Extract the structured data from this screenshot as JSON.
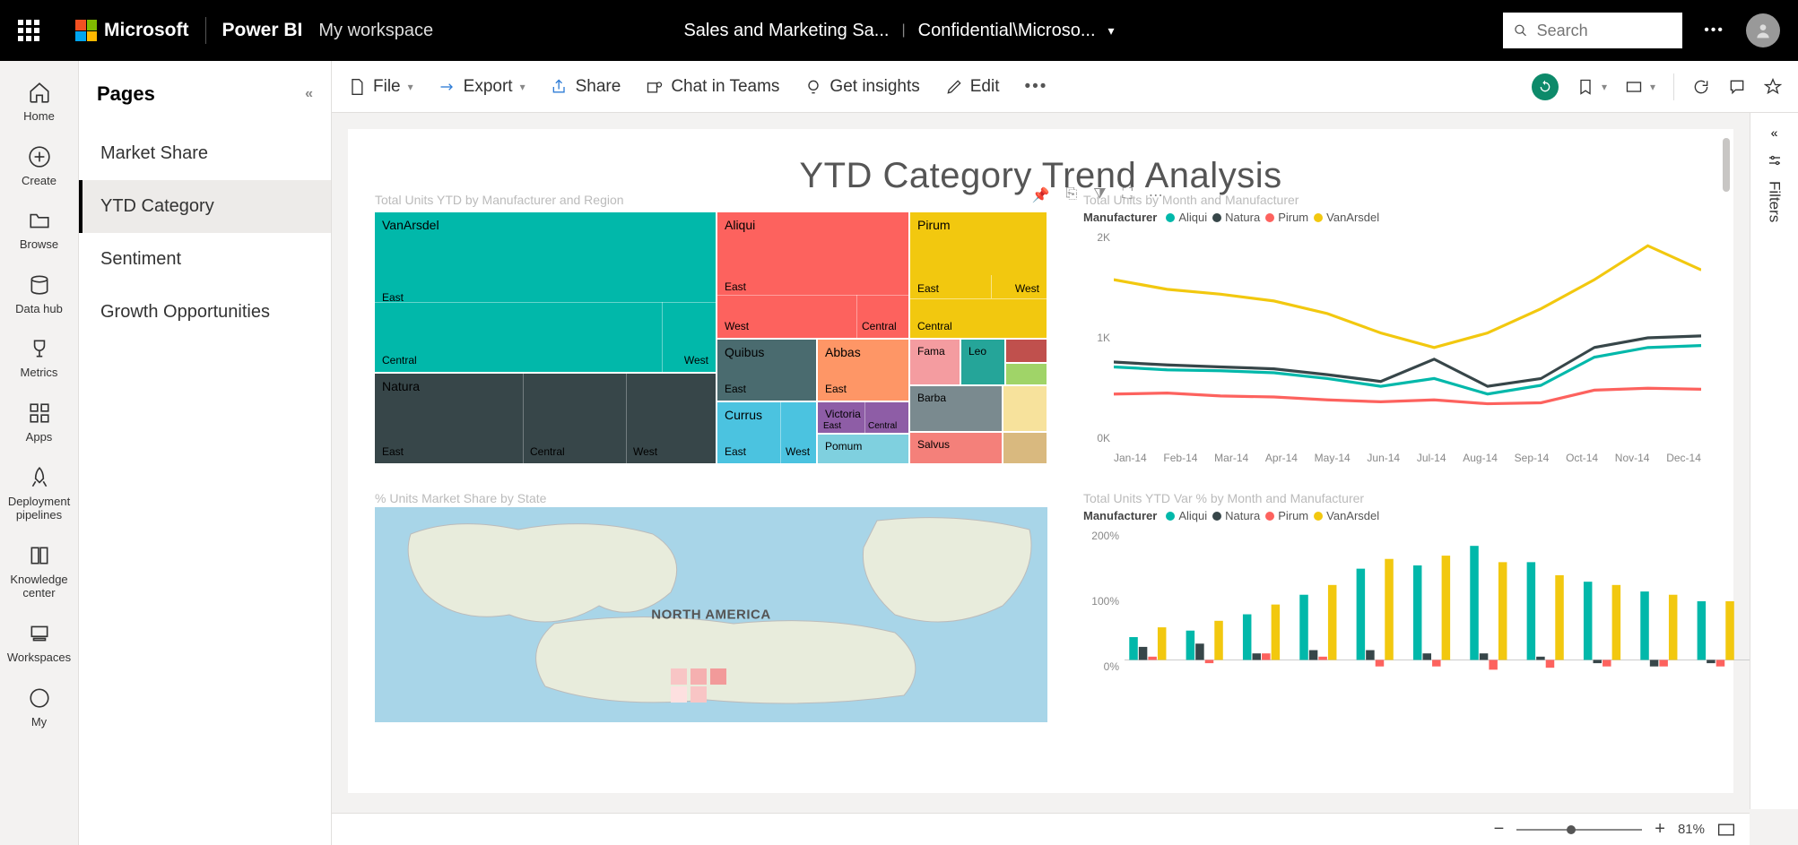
{
  "header": {
    "brand": "Microsoft",
    "product": "Power BI",
    "workspace": "My workspace",
    "report_title": "Sales and Marketing Sa...",
    "sensitivity": "Confidential\\Microso..."
  },
  "search": {
    "placeholder": "Search"
  },
  "rail": {
    "home": "Home",
    "create": "Create",
    "browse": "Browse",
    "datahub": "Data hub",
    "metrics": "Metrics",
    "apps": "Apps",
    "pipelines": "Deployment pipelines",
    "knowledge": "Knowledge center",
    "workspaces": "Workspaces",
    "my": "My"
  },
  "pages": {
    "header": "Pages",
    "items": [
      "Market Share",
      "YTD Category",
      "Sentiment",
      "Growth Opportunities"
    ],
    "active_index": 1
  },
  "commands": {
    "file": "File",
    "export": "Export",
    "share": "Share",
    "chat": "Chat in Teams",
    "insights": "Get insights",
    "edit": "Edit"
  },
  "zoom": {
    "percent": "81%"
  },
  "filters": {
    "label": "Filters"
  },
  "report": {
    "title": "YTD Category Trend Analysis",
    "treemap": {
      "title": "Total Units YTD by Manufacturer and Region",
      "labels": {
        "vanarsdel": "VanArsdel",
        "natura": "Natura",
        "aliqui": "Aliqui",
        "quibus": "Quibus",
        "currus": "Currus",
        "pirum": "Pirum",
        "abbas": "Abbas",
        "victoria": "Victoria",
        "pomum": "Pomum",
        "fama": "Fama",
        "leo": "Leo",
        "barba": "Barba",
        "salvus": "Salvus",
        "east": "East",
        "west": "West",
        "central": "Central"
      }
    },
    "line": {
      "title": "Total Units by Month and Manufacturer",
      "legend_label": "Manufacturer",
      "y_ticks": [
        "2K",
        "1K",
        "0K"
      ],
      "x_ticks": [
        "Jan-14",
        "Feb-14",
        "Mar-14",
        "Apr-14",
        "May-14",
        "Jun-14",
        "Jul-14",
        "Aug-14",
        "Sep-14",
        "Oct-14",
        "Nov-14",
        "Dec-14"
      ]
    },
    "map": {
      "title": "% Units Market Share by State",
      "label": "NORTH AMERICA"
    },
    "bars": {
      "title": "Total Units YTD Var % by Month and Manufacturer",
      "legend_label": "Manufacturer",
      "y_ticks": [
        "200%",
        "100%",
        "0%"
      ]
    },
    "legend_series": {
      "aliqui": "Aliqui",
      "natura": "Natura",
      "pirum": "Pirum",
      "vanarsdel": "VanArsdel"
    }
  },
  "colors": {
    "aliqui": "#01b8aa",
    "natura": "#374649",
    "pirum": "#fd625e",
    "vanarsdel": "#f2c80f",
    "orange": "#fe9666",
    "purple": "#8e5da6",
    "sky": "#4bc3e0",
    "teal": "#25a599"
  },
  "chart_data": [
    {
      "type": "treemap",
      "title": "Total Units YTD by Manufacturer and Region",
      "hierarchy": [
        {
          "name": "VanArsdel",
          "children": [
            {
              "name": "East",
              "value": 180
            },
            {
              "name": "West",
              "value": 60
            }
          ]
        },
        {
          "name": "Natura",
          "children": [
            {
              "name": "East",
              "value": 70
            },
            {
              "name": "Central",
              "value": 50
            },
            {
              "name": "West",
              "value": 40
            }
          ]
        },
        {
          "name": "Aliqui",
          "children": [
            {
              "name": "East",
              "value": 70
            },
            {
              "name": "West",
              "value": 40
            },
            {
              "name": "Central",
              "value": 20
            }
          ]
        },
        {
          "name": "Quibus",
          "children": [
            {
              "name": "East",
              "value": 35
            }
          ]
        },
        {
          "name": "Currus",
          "children": [
            {
              "name": "East",
              "value": 25
            },
            {
              "name": "West",
              "value": 20
            }
          ]
        },
        {
          "name": "Pirum",
          "children": [
            {
              "name": "East",
              "value": 40
            },
            {
              "name": "West",
              "value": 20
            },
            {
              "name": "Central",
              "value": 20
            }
          ]
        },
        {
          "name": "Abbas",
          "children": [
            {
              "name": "East",
              "value": 20
            }
          ]
        },
        {
          "name": "Victoria",
          "children": [
            {
              "name": "East",
              "value": 12
            },
            {
              "name": "Central",
              "value": 10
            }
          ]
        },
        {
          "name": "Pomum",
          "children": [
            {
              "name": "East",
              "value": 18
            }
          ]
        },
        {
          "name": "Fama",
          "children": [
            {
              "name": "East",
              "value": 10
            }
          ]
        },
        {
          "name": "Leo",
          "children": [
            {
              "name": "East",
              "value": 8
            }
          ]
        },
        {
          "name": "Barba",
          "children": [
            {
              "name": "East",
              "value": 12
            }
          ]
        },
        {
          "name": "Salvus",
          "children": [
            {
              "name": "East",
              "value": 10
            }
          ]
        }
      ]
    },
    {
      "type": "line",
      "title": "Total Units by Month and Manufacturer",
      "xlabel": "",
      "ylabel": "",
      "ylim": [
        0,
        2200
      ],
      "categories": [
        "Jan-14",
        "Feb-14",
        "Mar-14",
        "Apr-14",
        "May-14",
        "Jun-14",
        "Jul-14",
        "Aug-14",
        "Sep-14",
        "Oct-14",
        "Nov-14",
        "Dec-14"
      ],
      "series": [
        {
          "name": "VanArsdel",
          "values": [
            1700,
            1600,
            1550,
            1480,
            1350,
            1150,
            1000,
            1150,
            1400,
            1700,
            2050,
            1800
          ]
        },
        {
          "name": "Natura",
          "values": [
            850,
            820,
            800,
            780,
            720,
            650,
            880,
            600,
            680,
            1000,
            1100,
            1120
          ]
        },
        {
          "name": "Aliqui",
          "values": [
            800,
            770,
            760,
            740,
            680,
            600,
            680,
            520,
            610,
            900,
            1000,
            1020
          ]
        },
        {
          "name": "Pirum",
          "values": [
            520,
            530,
            500,
            490,
            460,
            440,
            460,
            420,
            430,
            560,
            580,
            570
          ]
        }
      ]
    },
    {
      "type": "bar",
      "title": "Total Units YTD Var % by Month and Manufacturer",
      "xlabel": "",
      "ylabel": "",
      "ylim": [
        -20,
        200
      ],
      "categories": [
        "Jan-14",
        "Feb-14",
        "Mar-14",
        "Apr-14",
        "May-14",
        "Jun-14",
        "Jul-14",
        "Aug-14",
        "Sep-14",
        "Oct-14",
        "Nov-14",
        "Dec-14"
      ],
      "series": [
        {
          "name": "Aliqui",
          "values": [
            35,
            45,
            70,
            100,
            140,
            145,
            175,
            150,
            120,
            105,
            90,
            125
          ]
        },
        {
          "name": "Natura",
          "values": [
            20,
            25,
            10,
            15,
            15,
            10,
            10,
            5,
            -5,
            -10,
            -5,
            5
          ]
        },
        {
          "name": "Pirum",
          "values": [
            5,
            -5,
            10,
            5,
            -10,
            -10,
            -15,
            -12,
            -10,
            -10,
            -10,
            -6
          ]
        },
        {
          "name": "VanArsdel",
          "values": [
            50,
            60,
            85,
            115,
            155,
            160,
            150,
            130,
            115,
            100,
            90,
            105
          ]
        }
      ]
    }
  ]
}
